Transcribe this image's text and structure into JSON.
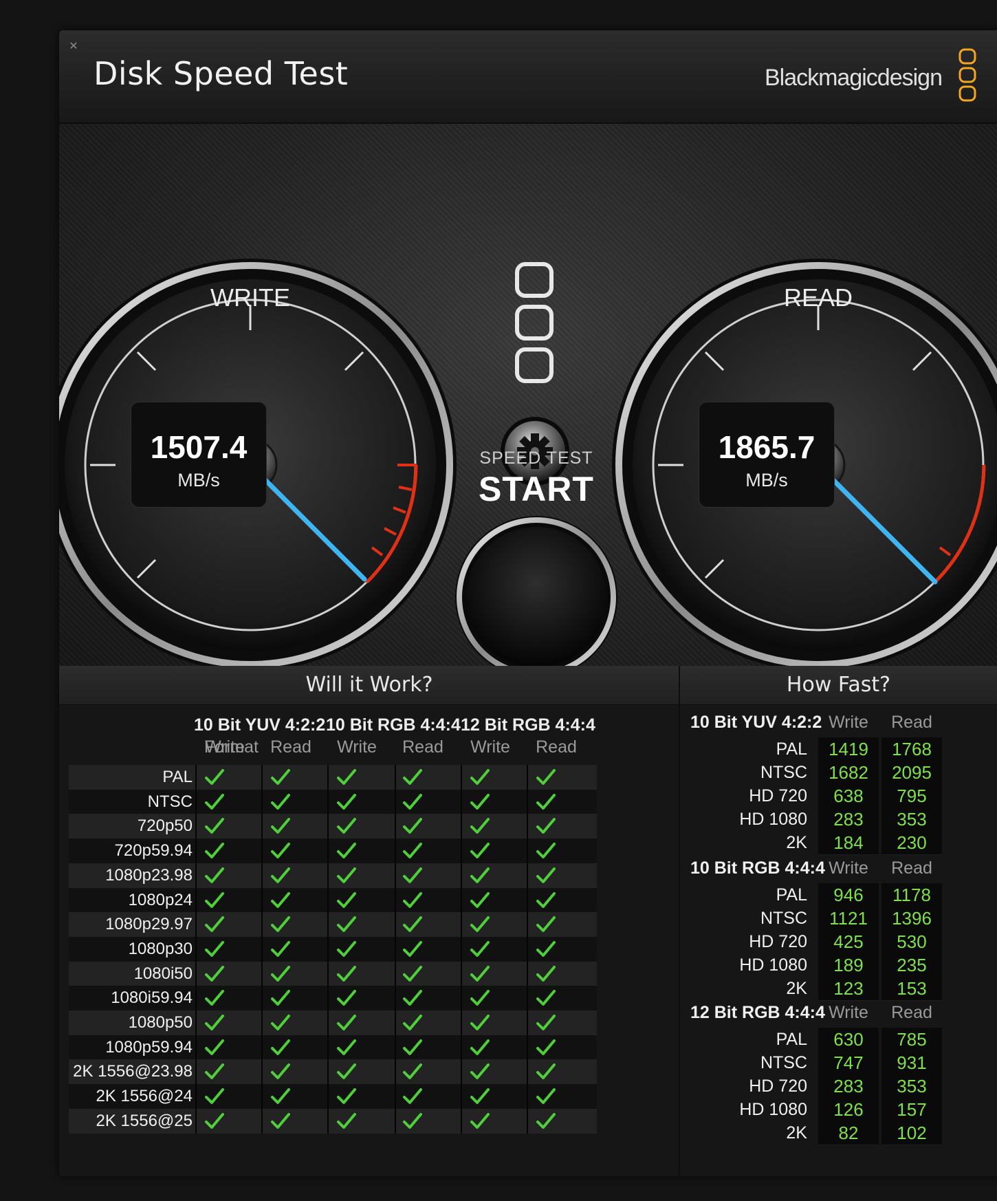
{
  "window": {
    "title": "Disk Speed Test",
    "brand": "Blackmagicdesign",
    "close_icon": "close-icon"
  },
  "gauges": {
    "write": {
      "label": "WRITE",
      "value": "1507.4",
      "unit": "MB/s"
    },
    "read": {
      "label": "READ",
      "value": "1865.7",
      "unit": "MB/s"
    }
  },
  "controls": {
    "start_top": "SPEED TEST",
    "start_main": "START",
    "settings_icon": "gear-icon"
  },
  "will_it_work": {
    "title": "Will it Work?",
    "format_label": "Format",
    "columns": [
      {
        "name": "10 Bit YUV 4:2:2",
        "write": "Write",
        "read": "Read"
      },
      {
        "name": "10 Bit RGB 4:4:4",
        "write": "Write",
        "read": "Read"
      },
      {
        "name": "12 Bit RGB 4:4:4",
        "write": "Write",
        "read": "Read"
      }
    ],
    "rows": [
      "PAL",
      "NTSC",
      "720p50",
      "720p59.94",
      "1080p23.98",
      "1080p24",
      "1080p29.97",
      "1080p30",
      "1080i50",
      "1080i59.94",
      "1080p50",
      "1080p59.94",
      "2K 1556@23.98",
      "2K 1556@24",
      "2K 1556@25"
    ],
    "status_icon": "checkmark-icon"
  },
  "how_fast": {
    "title": "How Fast?",
    "sections": [
      {
        "name": "10 Bit YUV 4:2:2",
        "write": "Write",
        "read": "Read",
        "rows": [
          {
            "label": "PAL",
            "write": "1419",
            "read": "1768"
          },
          {
            "label": "NTSC",
            "write": "1682",
            "read": "2095"
          },
          {
            "label": "HD 720",
            "write": "638",
            "read": "795"
          },
          {
            "label": "HD 1080",
            "write": "283",
            "read": "353"
          },
          {
            "label": "2K",
            "write": "184",
            "read": "230"
          }
        ]
      },
      {
        "name": "10 Bit RGB 4:4:4",
        "write": "Write",
        "read": "Read",
        "rows": [
          {
            "label": "PAL",
            "write": "946",
            "read": "1178"
          },
          {
            "label": "NTSC",
            "write": "1121",
            "read": "1396"
          },
          {
            "label": "HD 720",
            "write": "425",
            "read": "530"
          },
          {
            "label": "HD 1080",
            "write": "189",
            "read": "235"
          },
          {
            "label": "2K",
            "write": "123",
            "read": "153"
          }
        ]
      },
      {
        "name": "12 Bit RGB 4:4:4",
        "write": "Write",
        "read": "Read",
        "rows": [
          {
            "label": "PAL",
            "write": "630",
            "read": "785"
          },
          {
            "label": "NTSC",
            "write": "747",
            "read": "931"
          },
          {
            "label": "HD 720",
            "write": "283",
            "read": "353"
          },
          {
            "label": "HD 1080",
            "write": "126",
            "read": "157"
          },
          {
            "label": "2K",
            "write": "82",
            "read": "102"
          }
        ]
      }
    ]
  },
  "colors": {
    "needle": "#3fb4f0",
    "redline": "#e03015",
    "check": "#4fcf3a",
    "value_green": "#7ee04a",
    "logo_orange": "#f5a623"
  }
}
